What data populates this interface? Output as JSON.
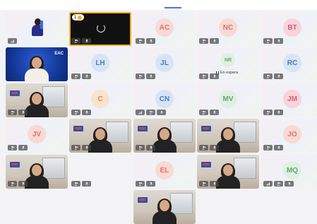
{
  "meeting": {
    "colors": {
      "active_speaker_border": "#f2b01e",
      "tab_indicator": "#4f6bed",
      "badge_bg": "#464646"
    },
    "participants": [
      {
        "id": "p1",
        "kind": "image",
        "initials": "",
        "badges": [
          "signal"
        ]
      },
      {
        "id": "p2",
        "kind": "active",
        "initials": "",
        "hand_raised_count": "1",
        "badges": [
          "people",
          "mic"
        ]
      },
      {
        "id": "p3",
        "kind": "avatar",
        "initials": "AC",
        "color": "#e0706a",
        "bg": "#f8d9d4",
        "badges": [
          "people",
          "mic"
        ]
      },
      {
        "id": "p4",
        "kind": "avatar",
        "initials": "NC",
        "color": "#e0706a",
        "bg": "#f8d9d4",
        "badges": [
          "people",
          "mic"
        ]
      },
      {
        "id": "p5",
        "kind": "avatar",
        "initials": "BT",
        "color": "#d0607a",
        "bg": "#f8d3dc",
        "badges": [
          "people",
          "mic"
        ]
      },
      {
        "id": "p6",
        "kind": "blue",
        "initials": "",
        "brand": "EAC",
        "badges": []
      },
      {
        "id": "p7",
        "kind": "avatar",
        "initials": "LH",
        "color": "#4a7cc0",
        "bg": "#d8e4f3",
        "badges": [
          "people",
          "mic"
        ]
      },
      {
        "id": "p8",
        "kind": "avatar",
        "initials": "JL",
        "color": "#4a7cc0",
        "bg": "#d8e4f3",
        "badges": [
          "people",
          "mic"
        ]
      },
      {
        "id": "p9",
        "kind": "avatar-small",
        "initials": "NR",
        "color": "#5fa870",
        "bg": "#e1efe3",
        "status": "En espera",
        "badges": [
          "people",
          "mic"
        ]
      },
      {
        "id": "p10",
        "kind": "avatar",
        "initials": "RC",
        "color": "#4a7cc0",
        "bg": "#d8e4f3",
        "badges": [
          "people",
          "mic"
        ]
      },
      {
        "id": "p11",
        "kind": "video",
        "initials": "",
        "badges": [
          "people",
          "mic"
        ]
      },
      {
        "id": "p12",
        "kind": "avatar",
        "initials": "C",
        "color": "#d98a3a",
        "bg": "#f8e3cf",
        "badges": [
          "people",
          "mic"
        ]
      },
      {
        "id": "p13",
        "kind": "avatar",
        "initials": "CN",
        "color": "#4a7cc0",
        "bg": "#d8e4f3",
        "badges": [
          "signal",
          "people",
          "mic"
        ]
      },
      {
        "id": "p14",
        "kind": "avatar",
        "initials": "MV",
        "color": "#5fa870",
        "bg": "#e1efe3",
        "badges": [
          "people",
          "mic"
        ]
      },
      {
        "id": "p15",
        "kind": "avatar",
        "initials": "JM",
        "color": "#d0607a",
        "bg": "#f8d3dc",
        "badges": [
          "people",
          "mic"
        ]
      },
      {
        "id": "p16",
        "kind": "avatar",
        "initials": "JV",
        "color": "#e0706a",
        "bg": "#f8d9d4",
        "badges": [
          "people",
          "mic"
        ]
      },
      {
        "id": "p17",
        "kind": "video",
        "initials": "",
        "badges": [
          "people",
          "mic"
        ]
      },
      {
        "id": "p18",
        "kind": "video",
        "initials": "",
        "badges": [
          "people",
          "mic"
        ]
      },
      {
        "id": "p19",
        "kind": "video",
        "initials": "",
        "badges": [
          "people",
          "mic"
        ]
      },
      {
        "id": "p20",
        "kind": "avatar",
        "initials": "JO",
        "color": "#e0706a",
        "bg": "#f8d9d4",
        "badges": [
          "people",
          "mic"
        ]
      },
      {
        "id": "p21",
        "kind": "video",
        "initials": "",
        "badges": [
          "people",
          "mic"
        ]
      },
      {
        "id": "p22",
        "kind": "blank-gray",
        "initials": "",
        "badges": [
          "people",
          "mic"
        ]
      },
      {
        "id": "p23",
        "kind": "avatar",
        "initials": "EL",
        "color": "#e0706a",
        "bg": "#f8d9d4",
        "badges": [
          "people",
          "mic"
        ]
      },
      {
        "id": "p24",
        "kind": "video",
        "initials": "",
        "badges": [
          "people",
          "mic"
        ]
      },
      {
        "id": "p25",
        "kind": "avatar",
        "initials": "MQ",
        "color": "#5fa870",
        "bg": "#e1efe3",
        "badges": [
          "signal",
          "people",
          "mic"
        ]
      },
      {
        "id": "p26",
        "kind": "video",
        "initials": "",
        "badges": []
      }
    ]
  }
}
